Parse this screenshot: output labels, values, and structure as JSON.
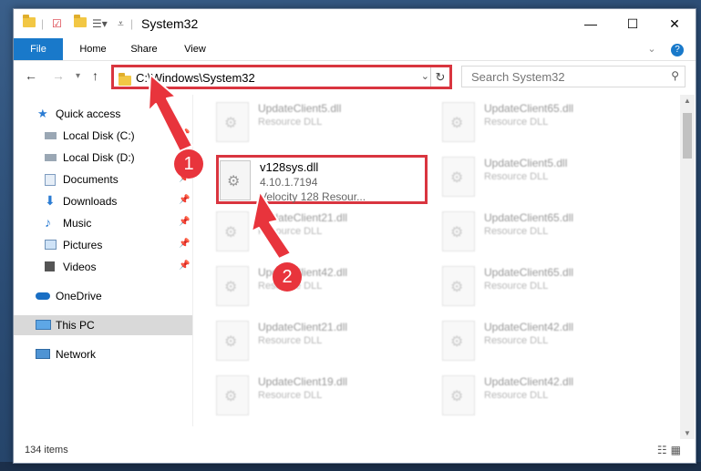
{
  "window": {
    "title": "System32",
    "minimize_glyph": "—",
    "maximize_glyph": "☐",
    "close_glyph": "✕"
  },
  "ribbon": {
    "tabs": [
      "File",
      "Home",
      "Share",
      "View"
    ],
    "help_glyph": "?"
  },
  "address": {
    "path": "C:\\Windows\\System32",
    "dropdown_glyph": "⌄",
    "refresh_glyph": "↻"
  },
  "search": {
    "placeholder": "Search System32",
    "icon": "search-icon"
  },
  "sidebar": {
    "items": [
      {
        "label": "Quick access",
        "icon": "star-icon",
        "pinned": false
      },
      {
        "label": "Local Disk (C:)",
        "icon": "drive-icon",
        "pinned": true
      },
      {
        "label": "Local Disk (D:)",
        "icon": "drive-icon",
        "pinned": false
      },
      {
        "label": "Documents",
        "icon": "documents-icon",
        "pinned": true
      },
      {
        "label": "Downloads",
        "icon": "download-icon",
        "pinned": true
      },
      {
        "label": "Music",
        "icon": "music-icon",
        "pinned": true
      },
      {
        "label": "Pictures",
        "icon": "pictures-icon",
        "pinned": true
      },
      {
        "label": "Videos",
        "icon": "videos-icon",
        "pinned": true
      },
      {
        "label": "OneDrive",
        "icon": "cloud-icon",
        "pinned": false
      },
      {
        "label": "This PC",
        "icon": "computer-icon",
        "pinned": false,
        "selected": true
      },
      {
        "label": "Network",
        "icon": "network-icon",
        "pinned": false
      }
    ]
  },
  "files": [
    {
      "name": "UpdateClient5.dll",
      "type": "Resource DLL"
    },
    {
      "name": "UpdateClient65.dll",
      "type": "Resource DLL"
    },
    {
      "name": "",
      "type": ""
    },
    {
      "name": "UpdateClient5.dll",
      "type": "Resource DLL"
    },
    {
      "name": "UpdateClient21.dll",
      "type": "Resource DLL"
    },
    {
      "name": "UpdateClient65.dll",
      "type": "Resource DLL"
    },
    {
      "name": "UpdateClient42.dll",
      "type": "Resource DLL"
    },
    {
      "name": "UpdateClient65.dll",
      "type": "Resource DLL"
    },
    {
      "name": "UpdateClient21.dll",
      "type": "Resource DLL"
    },
    {
      "name": "UpdateClient42.dll",
      "type": "Resource DLL"
    },
    {
      "name": "UpdateClient19.dll",
      "type": "Resource DLL"
    },
    {
      "name": "UpdateClient42.dll",
      "type": "Resource DLL"
    }
  ],
  "highlighted_file": {
    "name": "v128sys.dll",
    "version": "4.10.1.7194",
    "type": "Velocity 128 Resour..."
  },
  "annotations": {
    "step1": "1",
    "step2": "2",
    "accent_color": "#e8343c"
  },
  "status": {
    "count": "134 items"
  }
}
